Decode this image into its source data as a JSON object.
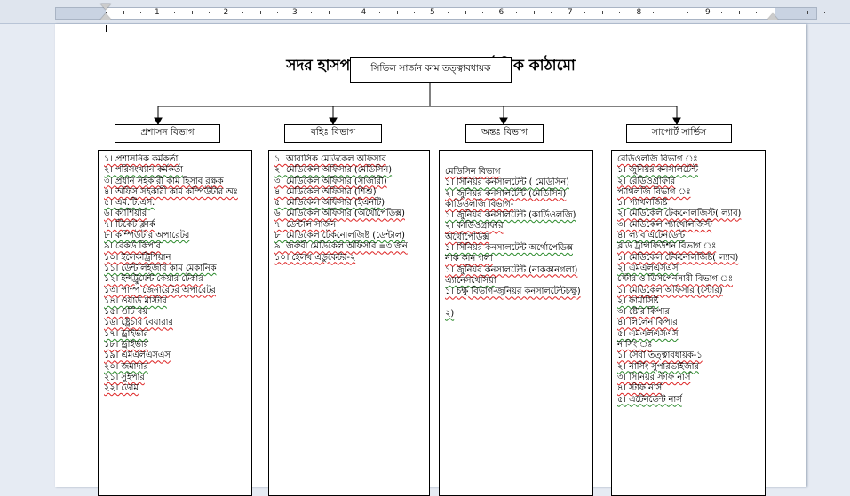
{
  "ruler": {
    "numbers": [
      "1",
      "2",
      "3",
      "4",
      "5",
      "6",
      "7",
      "8",
      "9"
    ]
  },
  "document": {
    "title": "সদর হাসপাতাল পঞ্চগড় এর সাংগঠনিক কাঠামো",
    "top_box": "সিভিল সার্জন কাম তত্ত্বাবধায়ক",
    "departments": [
      {
        "heading": "প্রশাসন বিভাগ",
        "items": [
          "১। প্রশাসনিক কর্মকর্তা",
          "২। পরিসংখ্যান কর্মকর্তা",
          "৩। প্রধান সহকারী কাম হিসাব রক্ষক",
          "৪। অফিস সহকারী কাম কম্পিউটার অঃ",
          "৫। এম.টি.এস.",
          "৬। ক্যাশিয়ার",
          "৭। টিকেট ক্লার্ক",
          "৮। কম্পিউটার অপারেটর",
          "৯। রেকর্ড কিপার",
          "১০। ইলেকট্রিশিয়ান",
          "১১। ডেন্টালইজার কাম মেকানিক",
          "১২। ইন্সট্রুমেন্ট কেয়ার টেকার",
          "১৩। পাম্প জেনারেটর অপারেটর",
          "১৪। ওয়ার্ড মাস্টার",
          "১৫। ওটি বয়",
          "১৬। ষ্ট্রেচার বেয়ারার",
          "১৭। ড্রাইভার",
          "১৮। ড্রাইভার",
          "১৯। এমএলএসএস",
          "২০। জমাদার",
          "২১। সুইপার",
          "২২। ডোম"
        ]
      },
      {
        "heading": "বহিঃ বিভাগ",
        "items": [
          "১। আবাসিক মেডিকেল অফিসার",
          "২। মেডিকেল অফিসার (মেডিসিন)",
          "৩। মেডিকেল অফিসার (সার্জারী)",
          "৪। মেডিকেল অফিসার (শিশু)",
          "৫। মেডিকেল অফিসার (ইএনটি)",
          "৬। মেডিকেল অফিসার (অর্থোপেডিক্স)",
          "৭। ডেন্টাল সার্জন",
          "৮। মেডিকেল টেকনোলজিষ্ট (ডেন্টাল)",
          "৯। জরুরী মেডিকেল অফিসার =৩ জন",
          "১০। হেলথ এডুকেটর-২"
        ]
      },
      {
        "heading": "অন্তঃ বিভাগ",
        "items": [
          "মেডিসিন বিভাগ",
          "১। সিনিয়র কনসালটেন্ট ( মেডিসিন)",
          "২। জুনিয়র কনসালটেন্ট (মেডিসিন)",
          "কার্ডিওলজি বিভাগ-",
          "১। জুনিয়র কনসালটেন্ট (কার্ডিওলজি)",
          "২। কার্ডিওগ্রাফার",
          "অর্থোপেডিক্স",
          "১। সিনিয়র কনসালটেন্ট অর্থোপেডিক্স",
          "নাক কান গলা",
          "১। জুনিয়র কনসালটেন্ট (নাককানগলা)",
          "এ্যানেসথেসিয়া",
          "১। চক্ষু বিভাগ-জুনিয়র কনসালটেন্টচক্ষু)",
          "",
          "২)"
        ]
      },
      {
        "heading": "সাপোর্ট সার্ভিস",
        "items": [
          "রেডিওলজি বিভাগ ঃ",
          "১। জুনিয়র কনসালটেন্ট",
          "২। রেডিওগ্রাফার",
          "প্যাথলজি বিভাগ ঃ",
          "১। প্যাথলজিষ্ট",
          "২। মেডিকেল টেকনোলজিস্ট( ল্যাব)",
          "৩। মেডিকেল প্যাথোলজিস্ট",
          "৪। ল্যাব এটেনডেন্ট",
          "ব্লাড ট্রান্সফিউশন বিভাগ ঃ",
          "১। মেডিকেল টেকনোলজিষ্ট( ল্যাব)",
          "২। এমএলএসএস",
          "স্টোর ও ডিসপেনসারী বিভাগ ঃ",
          "১। মেডিকেল অফিসার (স্টোর)",
          "২। ফার্মাসিষ্ট",
          "৩। ষ্টোর কিপার",
          "৪। লিলেন কিপার",
          "৫। এমএলএসএস",
          "নার্সিং ঃ",
          "১। সেবা তত্ত্বাবধায়ক-১",
          "২। নার্সিং সুপারভাইজার",
          "৩। সিনিয়র স্টাফ নার্স",
          "৪। স্টাফ নার্স",
          "৫। এটেনডেন্ট নার্স"
        ]
      }
    ]
  }
}
